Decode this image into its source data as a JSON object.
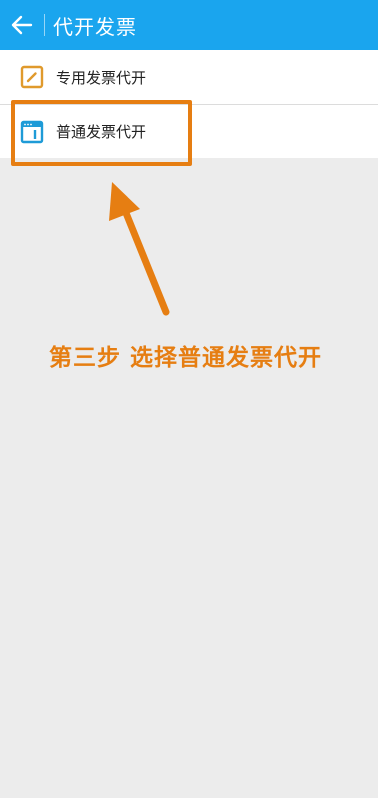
{
  "colors": {
    "header_bg": "#1aa5ee",
    "page_bg": "#ececec",
    "accent_orange": "#e67e12",
    "icon_orange": "#e09a2c",
    "icon_blue": "#1e9bd7"
  },
  "header": {
    "back_icon": "arrow-left-icon",
    "title": "代开发票"
  },
  "menu": {
    "items": [
      {
        "label": "专用发票代开",
        "icon": "edit-document-icon"
      },
      {
        "label": "普通发票代开",
        "icon": "window-document-icon"
      }
    ]
  },
  "annotation": {
    "text": "第三步 选择普通发票代开"
  }
}
